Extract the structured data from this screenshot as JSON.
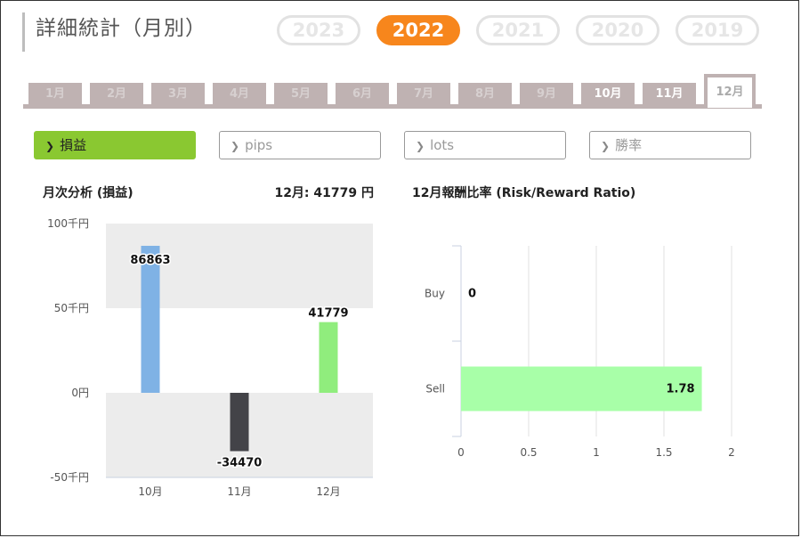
{
  "header": {
    "title": "詳細統計（月別）",
    "years": [
      {
        "label": "2023",
        "active": false
      },
      {
        "label": "2022",
        "active": true
      },
      {
        "label": "2021",
        "active": false
      },
      {
        "label": "2020",
        "active": false
      },
      {
        "label": "2019",
        "active": false
      }
    ]
  },
  "months": [
    {
      "label": "1月",
      "state": "empty"
    },
    {
      "label": "2月",
      "state": "empty"
    },
    {
      "label": "3月",
      "state": "empty"
    },
    {
      "label": "4月",
      "state": "empty"
    },
    {
      "label": "5月",
      "state": "empty"
    },
    {
      "label": "6月",
      "state": "empty"
    },
    {
      "label": "7月",
      "state": "empty"
    },
    {
      "label": "8月",
      "state": "empty"
    },
    {
      "label": "9月",
      "state": "empty"
    },
    {
      "label": "10月",
      "state": "data"
    },
    {
      "label": "11月",
      "state": "data"
    },
    {
      "label": "12月",
      "state": "active"
    }
  ],
  "filters": [
    {
      "label": "損益",
      "active": true
    },
    {
      "label": "pips",
      "active": false
    },
    {
      "label": "lots",
      "active": false
    },
    {
      "label": "勝率",
      "active": false
    }
  ],
  "monthly": {
    "title": "月次分析 (損益)",
    "summary": "12月:  41779 円"
  },
  "ratio": {
    "title": "12月報酬比率 (Risk/Reward Ratio)"
  },
  "chart_data": [
    {
      "type": "bar",
      "categories": [
        "10月",
        "11月",
        "12月"
      ],
      "values": [
        86863,
        -34470,
        41779
      ],
      "colors": [
        "#7fb2e5",
        "#434348",
        "#90ed7d"
      ],
      "ylim": [
        -50000,
        100000
      ],
      "yticks": [
        {
          "value": 100000,
          "label": "100千円"
        },
        {
          "value": 50000,
          "label": "50千円"
        },
        {
          "value": 0,
          "label": "0円"
        },
        {
          "value": -50000,
          "label": "-50千円"
        }
      ],
      "grid": false
    },
    {
      "type": "bar",
      "orientation": "horizontal",
      "categories": [
        "Buy",
        "Sell"
      ],
      "values": [
        0,
        1.78
      ],
      "data_labels": [
        "0",
        "1.78"
      ],
      "colors": [
        "#a8ffa8",
        "#a8ffa8"
      ],
      "xlim": [
        0,
        2
      ],
      "xticks": [
        "0",
        "0.5",
        "1",
        "1.5",
        "2"
      ],
      "grid": true
    }
  ]
}
